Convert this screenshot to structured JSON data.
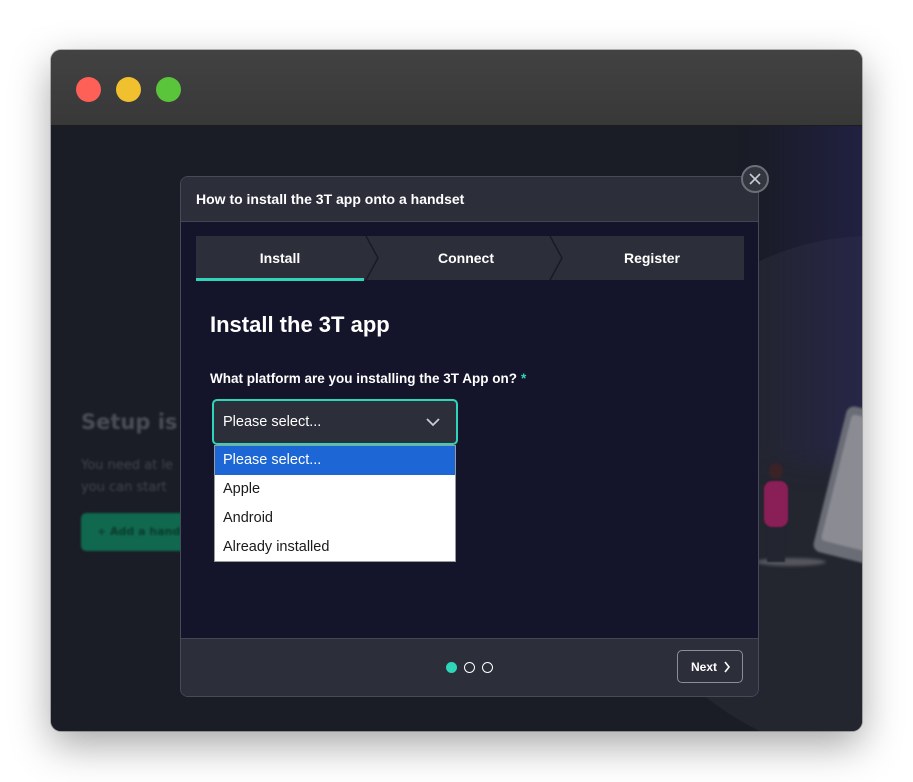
{
  "background_page": {
    "heading": "Setup is i",
    "text_line_1": "You need at le",
    "text_line_2": "you can start",
    "add_button_label": "+ Add a hand"
  },
  "modal": {
    "title": "How to install the 3T app onto a handset",
    "close_icon": "close-icon",
    "steps": [
      {
        "label": "Install",
        "active": true
      },
      {
        "label": "Connect",
        "active": false
      },
      {
        "label": "Register",
        "active": false
      }
    ],
    "section_title": "Install the 3T app",
    "field": {
      "label": "What platform are you installing the 3T App on?",
      "required_mark": "*",
      "selected_value": "Please select...",
      "options": [
        "Please select...",
        "Apple",
        "Android",
        "Already installed"
      ],
      "highlighted_option": "Please select..."
    },
    "pagination": {
      "current": 1,
      "total": 3
    },
    "next_label": "Next"
  },
  "colors": {
    "accent": "#2fd5b8",
    "modal_bg": "#14152a",
    "panel_bg": "#2c2f3a",
    "option_highlight": "#1c66d6"
  }
}
